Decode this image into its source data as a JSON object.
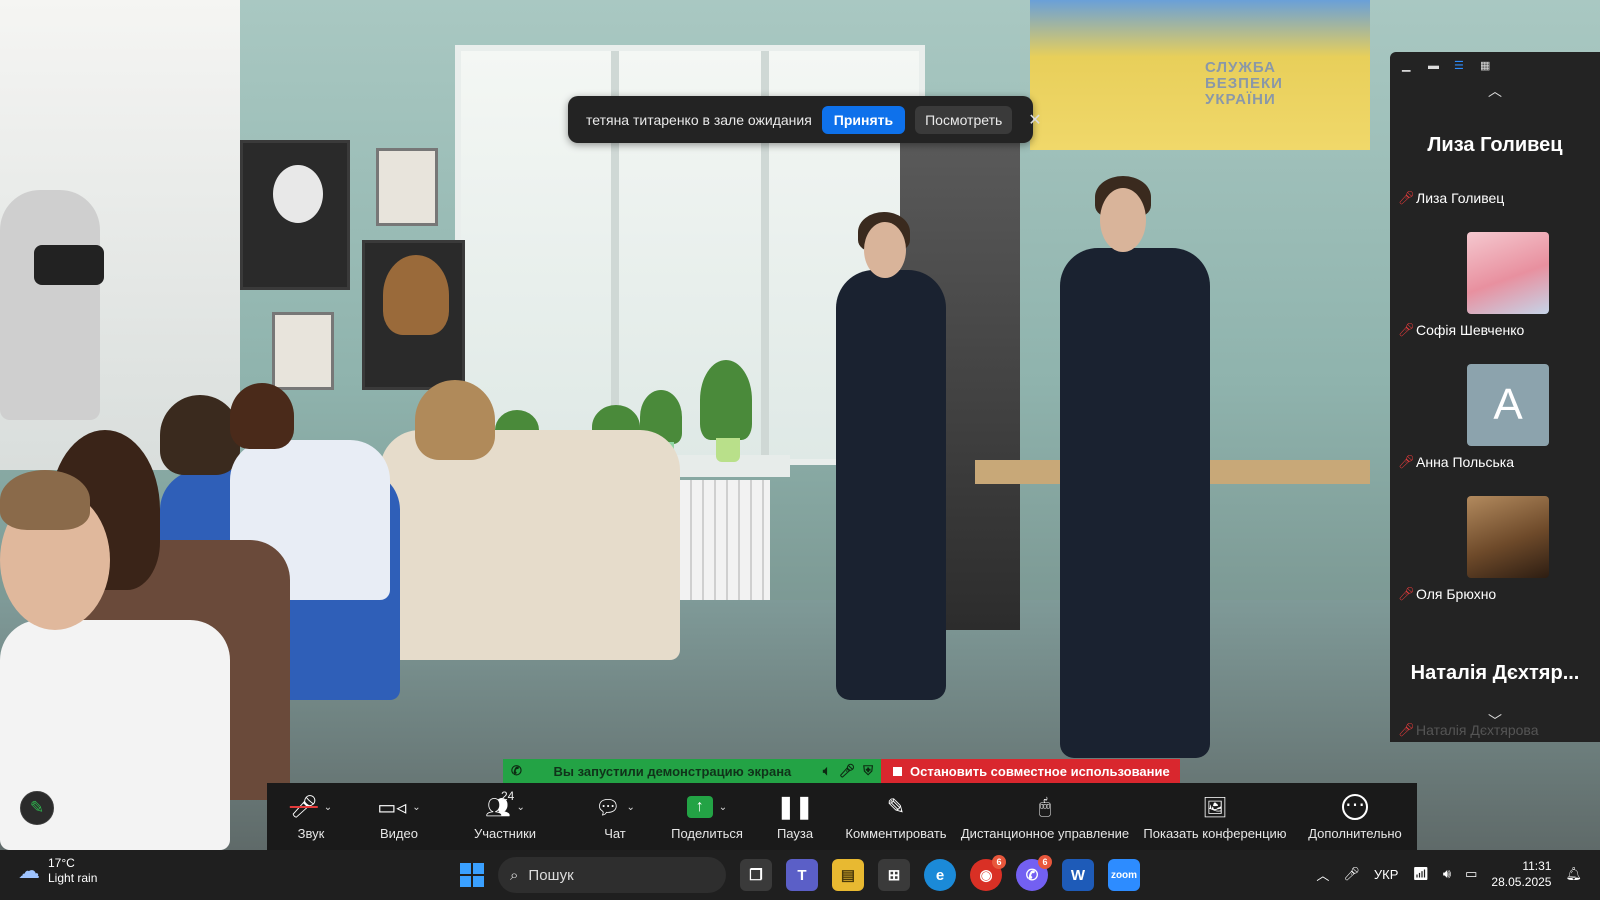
{
  "notification": {
    "text": "тетяна титаренко в зале ожидания",
    "accept_label": "Принять",
    "view_label": "Посмотреть",
    "close_icon": "close-icon"
  },
  "video": {
    "flag_text_line1": "СЛУЖБА",
    "flag_text_line2": "БЕЗПЕКИ",
    "flag_text_line3": "УКРАЇНИ"
  },
  "panel": {
    "header_icons": [
      "minimize-icon",
      "speaker-view-icon",
      "strip-view-icon",
      "gallery-view-icon"
    ],
    "participants": [
      {
        "big_name": "Лиза Голивец",
        "label": "Лиза Голивец",
        "muted": true,
        "thumb": "none"
      },
      {
        "label": "Софія Шевченко",
        "muted": true,
        "thumb": "anime-avatar"
      },
      {
        "label": "Анна Польська",
        "muted": true,
        "thumb": "letter",
        "letter": "A"
      },
      {
        "label": "Оля Брюхно",
        "muted": true,
        "thumb": "photo"
      },
      {
        "big_name": "Наталія Дєхтяр...",
        "label": "Наталія Дєхтярова",
        "muted": true,
        "thumb": "none"
      }
    ]
  },
  "sharing": {
    "status": "Вы запустили демонстрацию экрана",
    "stop_label": "Остановить совместное использование",
    "status_color": "#23a345",
    "stop_color": "#d9272e"
  },
  "toolbar": {
    "items": [
      {
        "label": "Звук",
        "icon": "mic-muted-icon"
      },
      {
        "label": "Видео",
        "icon": "video-camera-icon"
      },
      {
        "label": "Участники",
        "icon": "participants-icon",
        "count": "24"
      },
      {
        "label": "Чат",
        "icon": "chat-icon"
      },
      {
        "label": "Поделиться",
        "icon": "share-screen-icon"
      },
      {
        "label": "Пауза",
        "icon": "pause-icon"
      },
      {
        "label": "Комментировать",
        "icon": "annotate-pen-icon"
      },
      {
        "label": "Дистанционное управление",
        "icon": "mouse-icon"
      },
      {
        "label": "Показать конференцию",
        "icon": "show-meeting-icon"
      },
      {
        "label": "Дополнительно",
        "icon": "more-icon"
      }
    ]
  },
  "taskbar": {
    "weather_temp": "17°C",
    "weather_desc": "Light rain",
    "search_placeholder": "Пошук",
    "apps": [
      {
        "name": "task-view",
        "badge": ""
      },
      {
        "name": "teams",
        "badge": ""
      },
      {
        "name": "file-explorer",
        "badge": ""
      },
      {
        "name": "ms-store",
        "badge": ""
      },
      {
        "name": "edge",
        "badge": ""
      },
      {
        "name": "chrome",
        "badge": "6"
      },
      {
        "name": "viber",
        "badge": "6"
      },
      {
        "name": "word",
        "badge": ""
      },
      {
        "name": "zoom",
        "badge": ""
      }
    ],
    "language": "УКР",
    "time": "11:31",
    "date": "28.05.2025"
  }
}
